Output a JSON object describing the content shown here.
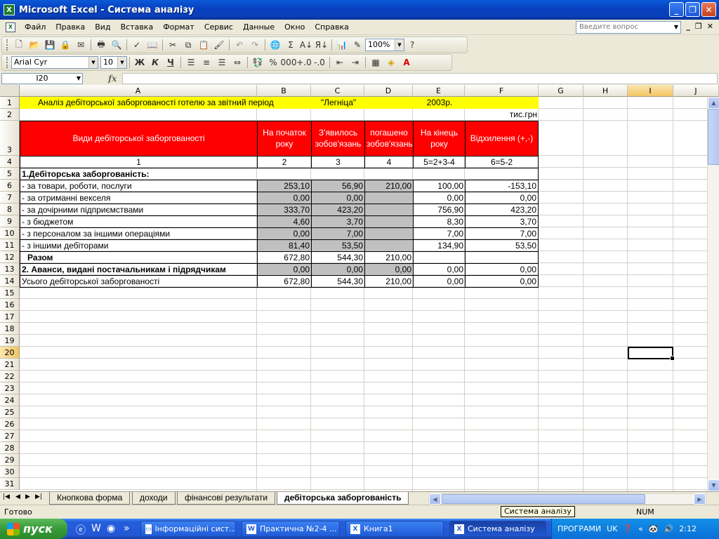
{
  "window": {
    "title": "Microsoft Excel - Система аналізу",
    "icon": "excel-icon"
  },
  "menu": {
    "items": [
      "Файл",
      "Правка",
      "Вид",
      "Вставка",
      "Формат",
      "Сервис",
      "Данные",
      "Окно",
      "Справка"
    ],
    "help_placeholder": "Введите вопрос"
  },
  "toolbar": {
    "zoom": "100%",
    "font_name": "Arial Cyr",
    "font_size": "10",
    "bold": "Ж",
    "italic": "К",
    "underline": "Ч"
  },
  "formula_bar": {
    "name_box": "I20",
    "fx": "fx",
    "content": ""
  },
  "columns": [
    "A",
    "B",
    "C",
    "D",
    "E",
    "F",
    "G",
    "H",
    "I",
    "J"
  ],
  "rows": [
    "1",
    "2",
    "3",
    "4",
    "5",
    "6",
    "7",
    "8",
    "9",
    "10",
    "11",
    "12",
    "13",
    "14",
    "15",
    "16",
    "17",
    "18",
    "19",
    "20",
    "21",
    "22",
    "23",
    "24",
    "25",
    "26",
    "27",
    "28",
    "29",
    "30",
    "31"
  ],
  "sheet": {
    "title": "Аналіз дебіторської заборгованості готелю за звітний період",
    "hotel": "\"Легніца\"",
    "year": "2003р.",
    "unit": "тис.грн",
    "headers": [
      "Види дебіторської заборгованості",
      "На початок року",
      "З'явилось зобов'язань",
      "погашено зобов'язань",
      "На кінець року",
      "Відхилення (+,-)"
    ],
    "header_numbers": [
      "1",
      "2",
      "3",
      "4",
      "5=2+3-4",
      "6=5-2"
    ],
    "section1": "1.Дебіторська заборгованість:",
    "table": [
      {
        "label": " - за товари, роботи, послуги",
        "b": "253,10",
        "c": "56,90",
        "d": "210,00",
        "e": "100,00",
        "f": "-153,10"
      },
      {
        "label": " - за отриманні векселя",
        "b": "0,00",
        "c": "0,00",
        "d": "",
        "e": "0,00",
        "f": "0,00"
      },
      {
        "label": " - за дочірними підприємствами",
        "b": "333,70",
        "c": "423,20",
        "d": "",
        "e": "756,90",
        "f": "423,20"
      },
      {
        "label": " - з бюджетом",
        "b": "4,60",
        "c": "3,70",
        "d": "",
        "e": "8,30",
        "f": "3,70"
      },
      {
        "label": " - з персоналом за іншими операціями",
        "b": "0,00",
        "c": "7,00",
        "d": "",
        "e": "7,00",
        "f": "7,00"
      },
      {
        "label": " - з іншими дебіторами",
        "b": "81,40",
        "c": "53,50",
        "d": "",
        "e": "134,90",
        "f": "53,50"
      }
    ],
    "total": {
      "label": "Разом",
      "b": "672,80",
      "c": "544,30",
      "d": "210,00"
    },
    "advances": {
      "label": "2. Аванси, видані постачальникам і підрядчикам",
      "b": "0,00",
      "c": "0,00",
      "d": "0,00",
      "e": "0,00",
      "f": "0,00"
    },
    "grand_total": {
      "label": "Усього дебіторської заборгованості",
      "b": "672,80",
      "c": "544,30",
      "d": "210,00",
      "e": "0,00",
      "f": "0,00"
    }
  },
  "tabs": [
    "Кнопкова форма",
    "доходи",
    "фінансові результати",
    "дебіторська заборгованість"
  ],
  "status": {
    "left": "Готово",
    "tooltip": "Система аналізу",
    "num": "NUM"
  },
  "taskbar": {
    "start": "пуск",
    "tasks": [
      "Інформаційні сист...",
      "Практична №2-4 ...",
      "Книга1",
      "Система аналізу"
    ],
    "tray_label": "ПРОГРАМИ",
    "lang": "UK",
    "clock": "2:12"
  }
}
